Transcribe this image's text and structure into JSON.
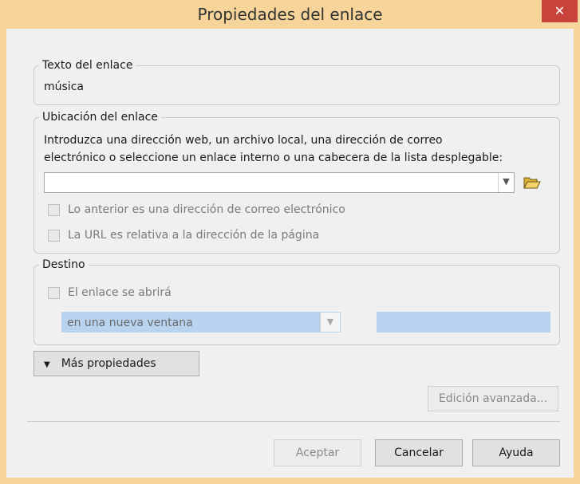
{
  "window": {
    "title": "Propiedades del enlace",
    "close_label": "✕"
  },
  "link_text": {
    "group_title": "Texto del enlace",
    "value": "música"
  },
  "location": {
    "group_title": "Ubicación del enlace",
    "instructions_line1": "Introduzca una dirección web, un archivo local, una dirección de correo",
    "instructions_line2": "electrónico o seleccione un enlace interno o una cabecera de la lista desplegable:",
    "url_value": "",
    "email_checkbox_label": "Lo anterior es una dirección de correo electrónico",
    "relative_checkbox_label": "La URL es relativa a la dirección de la página"
  },
  "target": {
    "group_title": "Destino",
    "open_checkbox_label": "El enlace se abrirá",
    "open_mode_value": "en una nueva ventana",
    "frame_name_value": ""
  },
  "buttons": {
    "more_properties": "Más propiedades",
    "advanced_edit": "Edición avanzada...",
    "accept": "Aceptar",
    "cancel": "Cancelar",
    "help": "Ayuda"
  },
  "colors": {
    "titlebar": "#f7d59a",
    "close_button": "#c8433a",
    "disabled_field": "#b8d3f0"
  }
}
